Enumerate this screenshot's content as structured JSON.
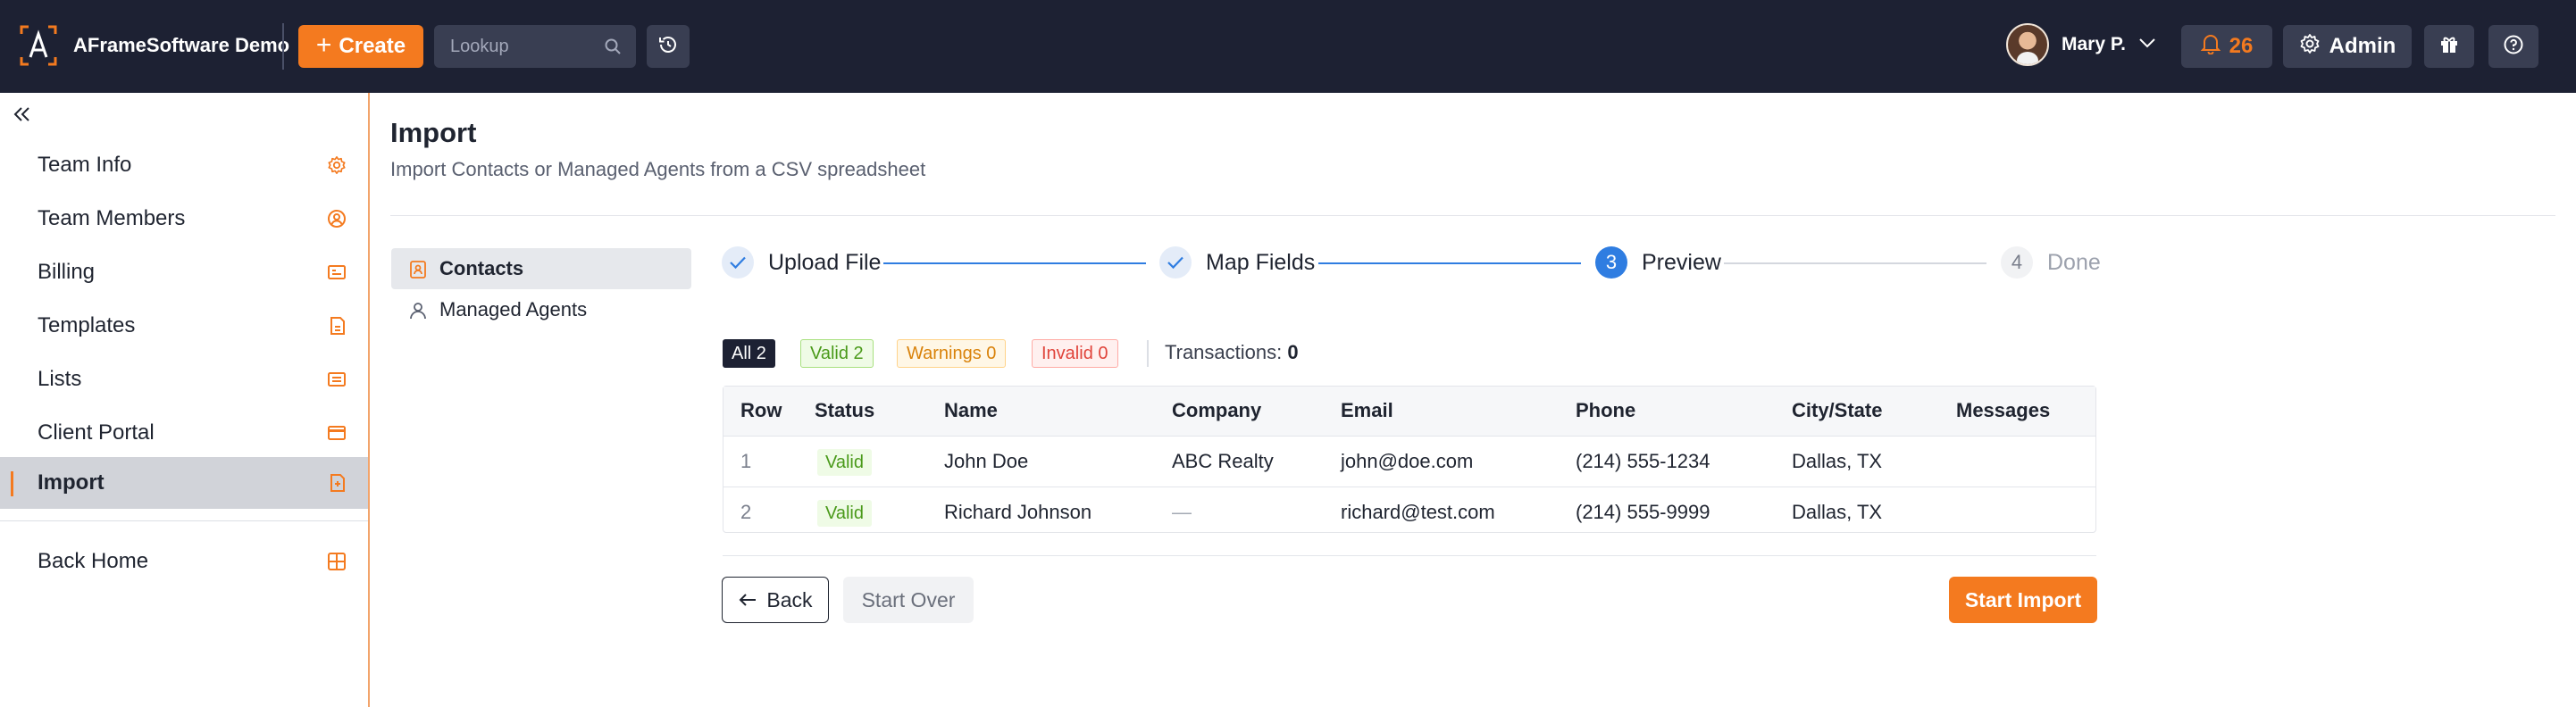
{
  "topbar": {
    "brand_name": "AFrameSoftware Demo",
    "create_label": "Create",
    "lookup_placeholder": "Lookup",
    "user_name": "Mary P.",
    "notification_count": "26",
    "admin_label": "Admin"
  },
  "sidebar": {
    "items": [
      {
        "label": "Team Info",
        "icon": "gear-icon"
      },
      {
        "label": "Team Members",
        "icon": "user-circle-icon"
      },
      {
        "label": "Billing",
        "icon": "billing-card-icon"
      },
      {
        "label": "Templates",
        "icon": "document-icon"
      },
      {
        "label": "Lists",
        "icon": "list-card-icon"
      },
      {
        "label": "Client Portal",
        "icon": "portal-card-icon"
      },
      {
        "label": "Import",
        "icon": "import-document-icon",
        "active": true
      }
    ],
    "back_home": {
      "label": "Back Home",
      "icon": "grid-icon"
    }
  },
  "page": {
    "title": "Import",
    "subtitle": "Import Contacts or Managed Agents from a CSV spreadsheet"
  },
  "sub_nav": [
    {
      "label": "Contacts",
      "icon": "contact-card-icon",
      "active": true
    },
    {
      "label": "Managed Agents",
      "icon": "person-icon",
      "active": false
    }
  ],
  "stepper": [
    {
      "number": "1",
      "label": "Upload File",
      "state": "done"
    },
    {
      "number": "2",
      "label": "Map Fields",
      "state": "done"
    },
    {
      "number": "3",
      "label": "Preview",
      "state": "current"
    },
    {
      "number": "4",
      "label": "Done",
      "state": "pending"
    }
  ],
  "filters": {
    "all": "All 2",
    "valid": "Valid 2",
    "warnings": "Warnings 0",
    "invalid": "Invalid 0",
    "transactions_label": "Transactions:",
    "transactions_value": "0"
  },
  "table": {
    "columns": [
      "Row",
      "Status",
      "Name",
      "Company",
      "Email",
      "Phone",
      "City/State",
      "Messages"
    ],
    "rows": [
      {
        "row": "1",
        "status": "Valid",
        "name": "John Doe",
        "company": "ABC Realty",
        "email": "john@doe.com",
        "phone": "(214) 555-1234",
        "city_state": "Dallas, TX",
        "messages": ""
      },
      {
        "row": "2",
        "status": "Valid",
        "name": "Richard Johnson",
        "company": "—",
        "email": "richard@test.com",
        "phone": "(214) 555-9999",
        "city_state": "Dallas, TX",
        "messages": ""
      }
    ]
  },
  "actions": {
    "back": "Back",
    "start_over": "Start Over",
    "start_import": "Start Import"
  },
  "colors": {
    "topbar_bg": "#1d2133",
    "accent_orange": "#f47a1f",
    "step_blue": "#2f7de1",
    "valid_green": "#4a9a1a"
  }
}
